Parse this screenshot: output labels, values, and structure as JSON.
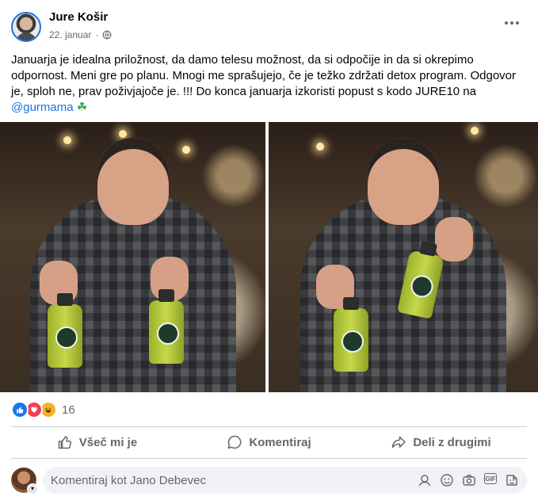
{
  "post": {
    "author": "Jure Košir",
    "date": "22. januar",
    "separator": "·",
    "text_main": "Januarja je idealna priložnost, da damo telesu možnost, da si odpočije in da si okrepimo odpornost. Meni gre po planu. Mnogi me sprašujejo, če je težko zdržati detox program. Odgovor je, sploh ne, prav poživjajoče je. !!! Do konca januarja izkoristi popust s kodo JURE10 na",
    "mention": "@gurmama",
    "clover": "☘"
  },
  "reactions": {
    "count": "16",
    "types": [
      "like",
      "love",
      "haha"
    ]
  },
  "actions": {
    "like": "Všeč mi je",
    "comment": "Komentiraj",
    "share": "Deli z drugimi"
  },
  "comment": {
    "placeholder": "Komentiraj kot Jano Debevec"
  },
  "icons": {
    "more": "more-horizontal-icon",
    "audience": "globe-icon",
    "like": "thumbs-up-icon",
    "comment": "speech-bubble-icon",
    "share": "share-arrow-icon",
    "comment_tools": [
      "avatar-sticker-icon",
      "emoji-icon",
      "camera-icon",
      "gif-icon",
      "sticker-icon"
    ]
  },
  "colors": {
    "accent": "#1b74e4",
    "like": "#1877f2",
    "love": "#f33e58",
    "haha": "#f7b125",
    "secondary_text": "#65676b"
  }
}
